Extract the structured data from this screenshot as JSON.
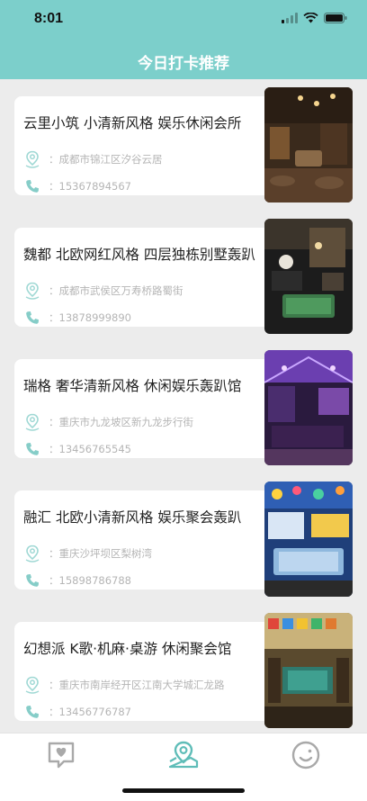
{
  "status_bar": {
    "time": "8:01"
  },
  "nav": {
    "title": "今日打卡推荐"
  },
  "venues": [
    {
      "title": "云里小筑 小清新风格 娱乐休闲会所",
      "address": "：成都市锦江区汐谷云居",
      "phone": "：15367894567"
    },
    {
      "title": "魏都 北欧网红风格 四层独栋别墅轰趴",
      "address": "：成都市武侯区万寿桥路蜀街",
      "phone": "：13878999890"
    },
    {
      "title": "瑞格 奢华清新风格 休闲娱乐轰趴馆",
      "address": "：重庆市九龙坡区新九龙步行街",
      "phone": "：13456765545"
    },
    {
      "title": "融汇 北欧小清新风格 娱乐聚会轰趴",
      "address": "：重庆沙坪坝区梨树湾",
      "phone": "：15898786788"
    },
    {
      "title": "幻想派 K歌·机麻·桌游 休闲聚会馆",
      "address": "：重庆市南岸经开区江南大学城汇龙路",
      "phone": "：13456776787"
    }
  ],
  "colors": {
    "header": "#7ccfcb",
    "accent": "#5fbdb8",
    "tab_inactive": "#a9a9a9"
  },
  "tabbar": {
    "items": [
      "heart-chat-icon",
      "map-pin-icon",
      "smile-icon"
    ],
    "active_index": 1
  }
}
